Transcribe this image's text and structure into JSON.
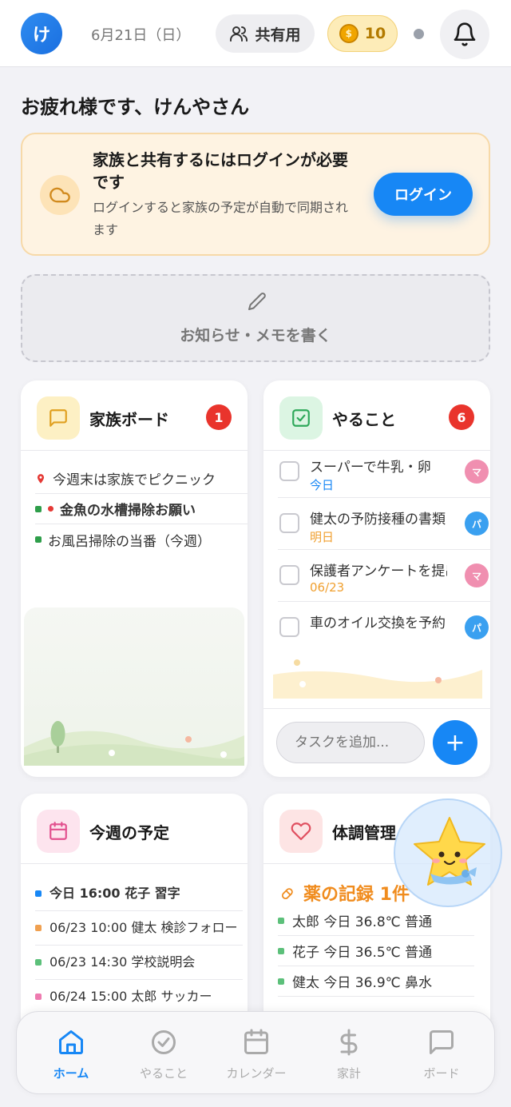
{
  "header": {
    "avatar_initial": "け",
    "date": "6月21日（日）",
    "share_label": "共有用",
    "coins": "10"
  },
  "greeting": "お疲れ様です、けんやさん",
  "login_card": {
    "title": "家族と共有するにはログインが必要です",
    "description": "ログインすると家族の予定が自動で同期されます",
    "button": "ログイン"
  },
  "memo": {
    "label": "お知らせ・メモを書く"
  },
  "family_board": {
    "title": "家族ボード",
    "badge": "1",
    "items": [
      {
        "text": "今週末は家族でピクニック",
        "marker": "pin"
      },
      {
        "text": "金魚の水槽掃除お願い",
        "marker": "square",
        "color": "#2e9e4a",
        "urgent": true
      },
      {
        "text": "お風呂掃除の当番（今週）",
        "marker": "square",
        "color": "#2e9e4a"
      }
    ]
  },
  "todo": {
    "title": "やること",
    "badge": "6",
    "items": [
      {
        "text": "スーパーで牛乳・卵",
        "due": "今日",
        "due_color": "#1787f5",
        "assignee": "マ",
        "assignee_color": "#f08fb0"
      },
      {
        "text": "健太の予防接種の書類",
        "due": "明日",
        "due_color": "#f0a030",
        "assignee": "パ",
        "assignee_color": "#3aa0f0"
      },
      {
        "text": "保護者アンケートを提出",
        "due": "06/23",
        "due_color": "#f0a030",
        "assignee": "マ",
        "assignee_color": "#f08fb0"
      },
      {
        "text": "車のオイル交換を予約",
        "due": "",
        "due_color": "#999",
        "assignee": "パ",
        "assignee_color": "#3aa0f0"
      }
    ],
    "input_placeholder": "タスクを追加...",
    "add_button": "+"
  },
  "schedule": {
    "title": "今週の予定",
    "items": [
      {
        "text": "今日 16:00 花子 習字",
        "color": "#1787f5",
        "bold": true
      },
      {
        "text": "06/23 10:00 健太 検診フォロー",
        "color": "#f0a050"
      },
      {
        "text": "06/23 14:30 学校説明会",
        "color": "#5cc07a"
      },
      {
        "text": "06/24 15:00 太郎 サッカー",
        "color": "#ee7bb0"
      }
    ]
  },
  "health": {
    "title": "体調管理",
    "medicine": "薬の記録 1件",
    "items": [
      {
        "text": "太郎 今日 36.8℃ 普通"
      },
      {
        "text": "花子 今日 36.5℃ 普通"
      },
      {
        "text": "健太 今日 36.9℃ 鼻水"
      }
    ]
  },
  "tabs": [
    {
      "label": "ホーム",
      "icon": "home-icon",
      "active": true
    },
    {
      "label": "やること",
      "icon": "check-circle-icon",
      "active": false
    },
    {
      "label": "カレンダー",
      "icon": "calendar-icon",
      "active": false
    },
    {
      "label": "家計",
      "icon": "dollar-icon",
      "active": false
    },
    {
      "label": "ボード",
      "icon": "chat-icon",
      "active": false
    }
  ],
  "colors": {
    "accent": "#1787f5",
    "badge": "#e9342c",
    "warning_bg": "#fef3e2",
    "medicine": "#f08c1e"
  }
}
